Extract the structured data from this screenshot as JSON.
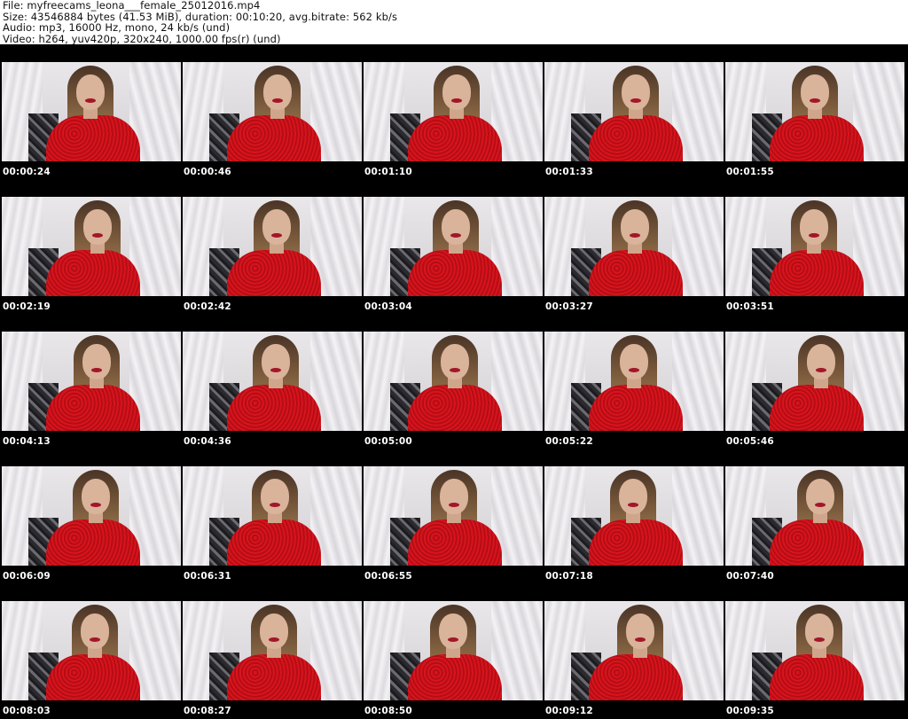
{
  "header": {
    "file_line": "File: myfreecams_leona___female_25012016.mp4",
    "size_line": "Size: 43546884 bytes (41.53 MiB), duration: 00:10:20, avg.bitrate: 562 kb/s",
    "audio_line": "Audio: mp3, 16000 Hz, mono, 24 kb/s (und)",
    "video_line": "Video: h264, yuv420p, 320x240, 1000.00 fps(r) (und)"
  },
  "thumbnails": [
    {
      "timestamp": "00:00:24"
    },
    {
      "timestamp": "00:00:46"
    },
    {
      "timestamp": "00:01:10"
    },
    {
      "timestamp": "00:01:33"
    },
    {
      "timestamp": "00:01:55"
    },
    {
      "timestamp": "00:02:19"
    },
    {
      "timestamp": "00:02:42"
    },
    {
      "timestamp": "00:03:04"
    },
    {
      "timestamp": "00:03:27"
    },
    {
      "timestamp": "00:03:51"
    },
    {
      "timestamp": "00:04:13"
    },
    {
      "timestamp": "00:04:36"
    },
    {
      "timestamp": "00:05:00"
    },
    {
      "timestamp": "00:05:22"
    },
    {
      "timestamp": "00:05:46"
    },
    {
      "timestamp": "00:06:09"
    },
    {
      "timestamp": "00:06:31"
    },
    {
      "timestamp": "00:06:55"
    },
    {
      "timestamp": "00:07:18"
    },
    {
      "timestamp": "00:07:40"
    },
    {
      "timestamp": "00:08:03"
    },
    {
      "timestamp": "00:08:27"
    },
    {
      "timestamp": "00:08:50"
    },
    {
      "timestamp": "00:09:12"
    },
    {
      "timestamp": "00:09:35"
    }
  ],
  "colors": {
    "grid_background": "#000000",
    "timestamp_text": "#ffffff",
    "dress": "#d8141c"
  }
}
